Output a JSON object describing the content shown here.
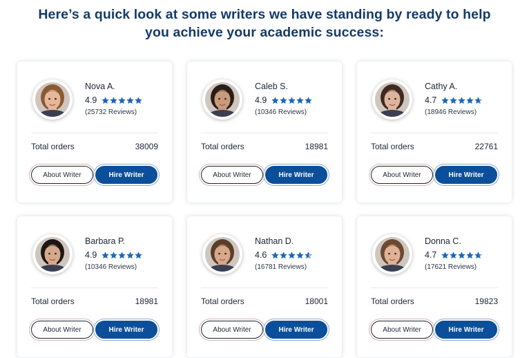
{
  "headline": {
    "line1": "Here’s a quick look at some writers we have standing by ready to help",
    "line2": "you achieve your academic success:"
  },
  "labels": {
    "total_orders": "Total orders",
    "about_button": "About Writer",
    "hire_button": "Hire Writer"
  },
  "colors": {
    "heading": "#143a6b",
    "star": "#1a67b8",
    "hire_button_bg": "#0b4f9b"
  },
  "writers": [
    {
      "name": "Nova A.",
      "rating": "4.9",
      "rating_value": 4.9,
      "reviews": "(25732 Reviews)",
      "total_orders": "38009",
      "avatar": "woman-light-hair-portrait",
      "skin": "#e6b799",
      "hair": "#8a5a34"
    },
    {
      "name": "Caleb S.",
      "rating": "4.9",
      "rating_value": 4.9,
      "reviews": "(10346 Reviews)",
      "total_orders": "18981",
      "avatar": "man-dark-hair-portrait",
      "skin": "#c99a7b",
      "hair": "#2b1d16"
    },
    {
      "name": "Cathy A.",
      "rating": "4.7",
      "rating_value": 4.7,
      "reviews": "(18946 Reviews)",
      "total_orders": "22761",
      "avatar": "woman-dark-hair-portrait",
      "skin": "#ddb49c",
      "hair": "#3e2a20"
    },
    {
      "name": "Barbara P.",
      "rating": "4.9",
      "rating_value": 4.9,
      "reviews": "(10346 Reviews)",
      "total_orders": "18981",
      "avatar": "woman-glasses-portrait",
      "skin": "#d6a98c",
      "hair": "#1e1714"
    },
    {
      "name": "Nathan D.",
      "rating": "4.6",
      "rating_value": 4.6,
      "reviews": "(16781 Reviews)",
      "total_orders": "18001",
      "avatar": "man-short-hair-portrait",
      "skin": "#d8a88a",
      "hair": "#5a3d2a"
    },
    {
      "name": "Donna C.",
      "rating": "4.7",
      "rating_value": 4.7,
      "reviews": "(17621 Reviews)",
      "total_orders": "19823",
      "avatar": "woman-brown-hair-portrait",
      "skin": "#dfb296",
      "hair": "#6b4a33"
    }
  ]
}
